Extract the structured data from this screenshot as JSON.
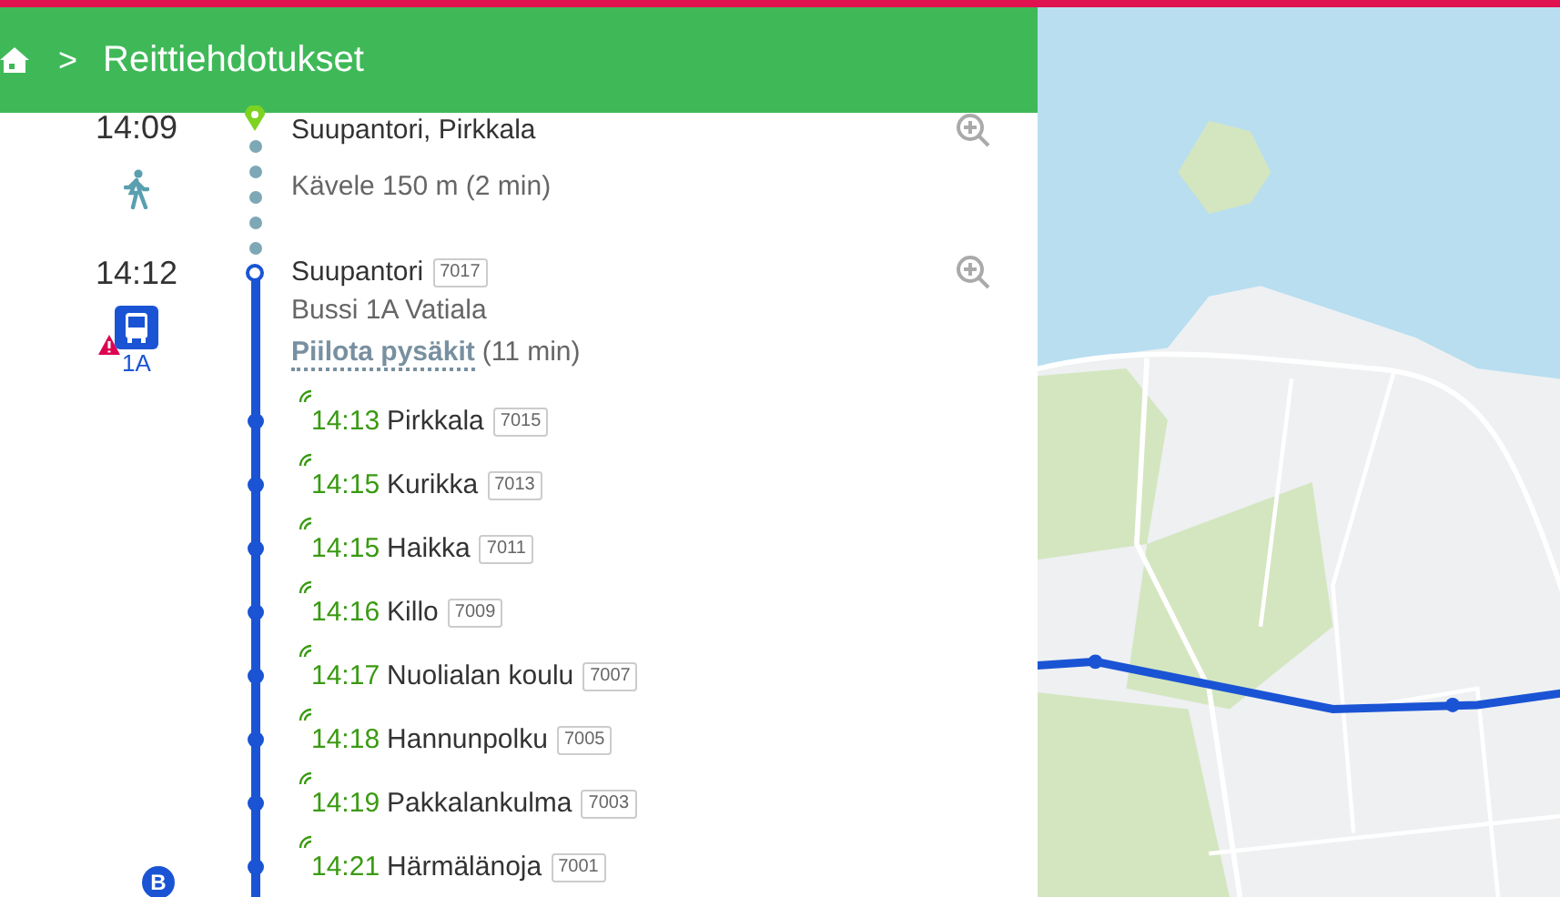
{
  "header": {
    "breadcrumb_separator": ">",
    "title": "Reittiehdotukset"
  },
  "legs": [
    {
      "kind": "walk",
      "time": "14:09",
      "place": "Suupantori, Pirkkala",
      "description": "Kävele 150 m (2 min)"
    },
    {
      "kind": "bus",
      "time": "14:12",
      "stop": "Suupantori",
      "code": "7017",
      "description": "Bussi 1A Vatiala",
      "route": "1A",
      "alert": true,
      "toggle": "Piilota pysäkit",
      "duration": "(11 min)",
      "stops": [
        {
          "time": "14:13",
          "name": "Pirkkala",
          "code": "7015",
          "realtime": true
        },
        {
          "time": "14:15",
          "name": "Kurikka",
          "code": "7013",
          "realtime": true
        },
        {
          "time": "14:15",
          "name": "Haikka",
          "code": "7011",
          "realtime": true
        },
        {
          "time": "14:16",
          "name": "Killo",
          "code": "7009",
          "realtime": true
        },
        {
          "time": "14:17",
          "name": "Nuolialan koulu",
          "code": "7007",
          "realtime": true
        },
        {
          "time": "14:18",
          "name": "Hannunpolku",
          "code": "7005",
          "realtime": true
        },
        {
          "time": "14:19",
          "name": "Pakkalankulma",
          "code": "7003",
          "realtime": true
        },
        {
          "time": "14:21",
          "name": "Härmälänoja",
          "code": "7001",
          "realtime": true,
          "marker": "B"
        }
      ]
    }
  ]
}
